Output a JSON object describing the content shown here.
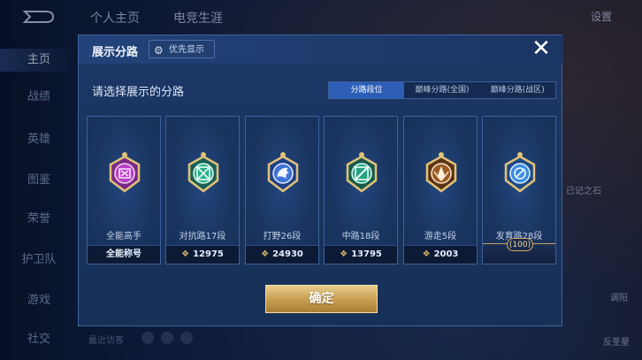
{
  "background": {
    "top_tabs": [
      "个人主页",
      "电竞生涯"
    ],
    "settings_label": "设置",
    "nav": [
      {
        "label": "主页",
        "active": true
      },
      {
        "label": "战绩",
        "active": false
      },
      {
        "label": "英雄",
        "active": false
      },
      {
        "label": "图鉴",
        "active": false
      },
      {
        "label": "荣誉",
        "active": false
      },
      {
        "label": "护卫队",
        "active": false
      },
      {
        "label": "游戏",
        "active": false
      },
      {
        "label": "社交",
        "active": false
      }
    ],
    "right_texts": [
      "已记之石",
      "调阳",
      "反圣星"
    ],
    "chat_placeholder": "最近访客"
  },
  "dialog": {
    "title": "展示分路",
    "priority_button": "优先显示",
    "close_icon": "close-icon",
    "prompt": "请选择展示的分路",
    "tabs": [
      {
        "label": "分路段位",
        "active": true
      },
      {
        "label": "巅峰分路(全国)",
        "active": false
      },
      {
        "label": "巅峰分路(战区)",
        "active": false
      }
    ],
    "cards": [
      {
        "label": "全能高手",
        "footer": "全能称号",
        "icon": "all-round-badge-icon",
        "color": "#b93fc7"
      },
      {
        "label": "对抗路17段",
        "footer": "12975",
        "icon": "clash-lane-badge-icon",
        "color": "#2fae8a"
      },
      {
        "label": "打野26段",
        "footer": "24930",
        "icon": "jungle-badge-icon",
        "color": "#3f74d6"
      },
      {
        "label": "中路18段",
        "footer": "13795",
        "icon": "mid-lane-badge-icon",
        "color": "#27a27f"
      },
      {
        "label": "游走5段",
        "footer": "2003",
        "icon": "roam-badge-icon",
        "color": "#9a5a24"
      },
      {
        "label": "发育路28段",
        "footer": "",
        "icon": "farm-lane-badge-icon",
        "color": "#3b8ee0",
        "badge_value": "100"
      }
    ],
    "confirm_button": "确定"
  }
}
